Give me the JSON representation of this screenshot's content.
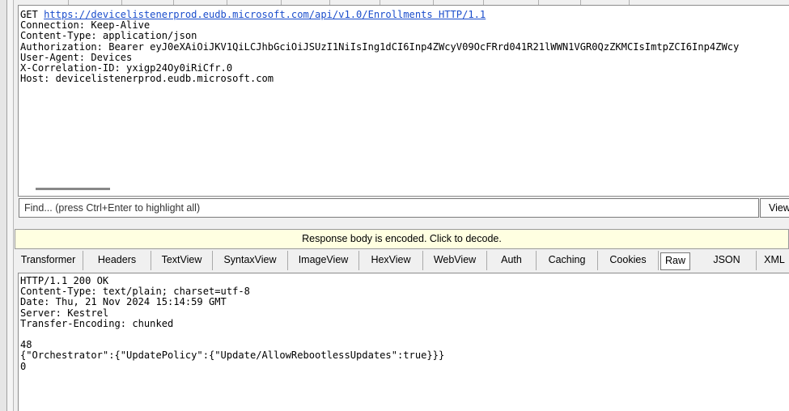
{
  "request": {
    "method": "GET",
    "url": "https://devicelistenerprod.eudb.microsoft.com/api/v1.0/Enrollments HTTP/1.1",
    "headers": [
      "Connection: Keep-Alive",
      "Content-Type: application/json",
      "Authorization: Bearer eyJ0eXAiOiJKV1QiLCJhbGciOiJSUzI1NiIsIng1dCI6Inp4ZWcyV09OcFRrd041R21lWWN1VGR0QzZKMCIsImtpZCI6Inp4ZWcy",
      "User-Agent: Devices",
      "X-Correlation-ID: yxigp24Oy0iRiCfr.0",
      "Host: devicelistenerprod.eudb.microsoft.com"
    ]
  },
  "find": {
    "placeholder": "Find... (press Ctrl+Enter to highlight all)",
    "view_button": "View"
  },
  "encoded_notice": "Response body is encoded. Click to decode.",
  "tabs": [
    "Transformer",
    "Headers",
    "TextView",
    "SyntaxView",
    "ImageView",
    "HexView",
    "WebView",
    "Auth",
    "Caching",
    "Cookies",
    "Raw",
    "JSON",
    "XML"
  ],
  "active_tab": "Raw",
  "response": {
    "lines": [
      "HTTP/1.1 200 OK",
      "Content-Type: text/plain; charset=utf-8",
      "Date: Thu, 21 Nov 2024 15:14:59 GMT",
      "Server: Kestrel",
      "Transfer-Encoding: chunked",
      "",
      "48",
      "{\"Orchestrator\":{\"UpdatePolicy\":{\"Update/AllowRebootlessUpdates\":true}}}",
      "0"
    ]
  }
}
